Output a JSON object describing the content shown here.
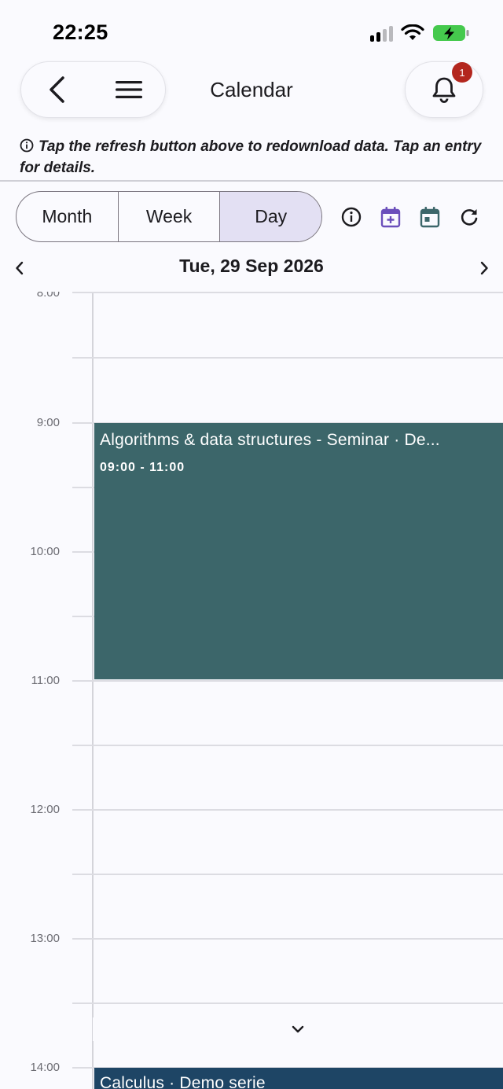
{
  "status_bar": {
    "time": "22:25"
  },
  "header": {
    "title": "Calendar",
    "notification_count": "1"
  },
  "info": {
    "text": "Tap the refresh button above to redownload data. Tap an entry for details."
  },
  "view_switch": {
    "month": "Month",
    "week": "Week",
    "day": "Day",
    "selected": "Day"
  },
  "date_nav": {
    "current_date": "Tue, 29 Sep 2026"
  },
  "day_grid": {
    "hours": [
      "8:00",
      "9:00",
      "10:00",
      "11:00",
      "12:00",
      "13:00",
      "14:00"
    ]
  },
  "events": [
    {
      "title": "Algorithms & data structures - Seminar · De...",
      "time": "09:00 - 11:00",
      "color": "#3c666a"
    },
    {
      "title": "Calculus · Demo serie",
      "time": "",
      "color": "#1e4565"
    }
  ],
  "colors": {
    "accent_purple": "#6b4fbb",
    "accent_teal": "#3c666a",
    "badge_red": "#b3261e"
  }
}
